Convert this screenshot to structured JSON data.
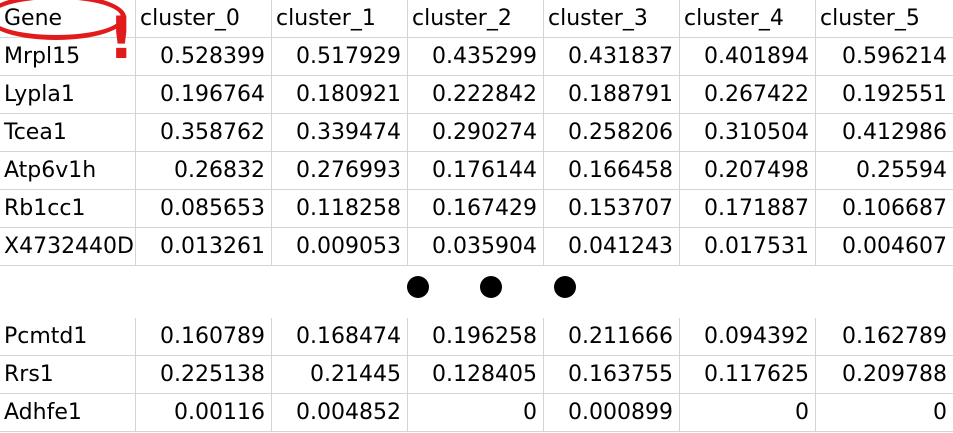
{
  "header": {
    "gene_label": "Gene",
    "columns": [
      "cluster_0",
      "cluster_1",
      "cluster_2",
      "cluster_3",
      "cluster_4",
      "cluster_5"
    ]
  },
  "rows_top": [
    {
      "gene": "Mrpl15",
      "values": [
        "0.528399",
        "0.517929",
        "0.435299",
        "0.431837",
        "0.401894",
        "0.596214"
      ]
    },
    {
      "gene": "Lypla1",
      "values": [
        "0.196764",
        "0.180921",
        "0.222842",
        "0.188791",
        "0.267422",
        "0.192551"
      ]
    },
    {
      "gene": "Tcea1",
      "values": [
        "0.358762",
        "0.339474",
        "0.290274",
        "0.258206",
        "0.310504",
        "0.412986"
      ]
    },
    {
      "gene": "Atp6v1h",
      "values": [
        "0.26832",
        "0.276993",
        "0.176144",
        "0.166458",
        "0.207498",
        "0.25594"
      ]
    },
    {
      "gene": "Rb1cc1",
      "values": [
        "0.085653",
        "0.118258",
        "0.167429",
        "0.153707",
        "0.171887",
        "0.106687"
      ]
    },
    {
      "gene": "X4732440D",
      "values": [
        "0.013261",
        "0.009053",
        "0.035904",
        "0.041243",
        "0.017531",
        "0.004607"
      ]
    }
  ],
  "rows_bottom": [
    {
      "gene": "Pcmtd1",
      "values": [
        "0.160789",
        "0.168474",
        "0.196258",
        "0.211666",
        "0.094392",
        "0.162789"
      ]
    },
    {
      "gene": "Rrs1",
      "values": [
        "0.225138",
        "0.21445",
        "0.128405",
        "0.163755",
        "0.117625",
        "0.209788"
      ]
    },
    {
      "gene": "Adhfe1",
      "values": [
        "0.00116",
        "0.004852",
        "0",
        "0.000899",
        "0",
        "0"
      ]
    }
  ],
  "annotation": {
    "exclamation": "!",
    "color": "#e11b1b"
  }
}
